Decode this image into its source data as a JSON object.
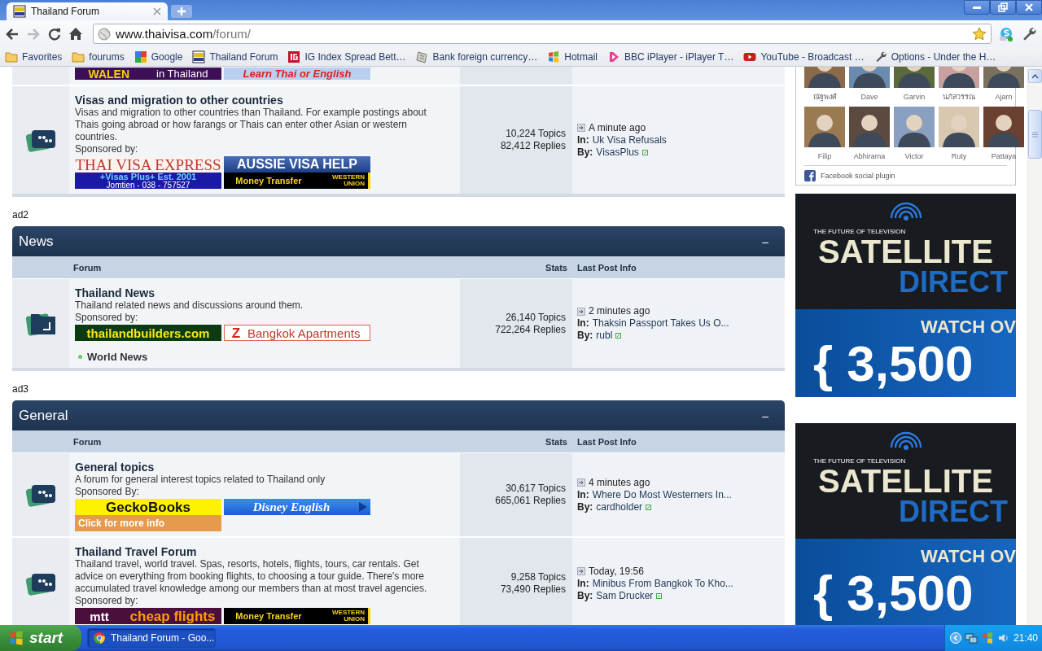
{
  "browser": {
    "tabs": [
      {
        "title": "Thailand Forum",
        "selected": true
      }
    ],
    "address": {
      "host": "www.thaivisa.com",
      "path": "/forum/"
    },
    "bookmarks": [
      {
        "kind": "folder",
        "label": "Favorites"
      },
      {
        "kind": "folder",
        "label": "fourums"
      },
      {
        "kind": "google",
        "label": "Google"
      },
      {
        "kind": "thaivisa",
        "label": "Thailand Forum"
      },
      {
        "kind": "ig",
        "label": "IG Index  Spread Bett…"
      },
      {
        "kind": "bank",
        "label": "Bank foreign currency…"
      },
      {
        "kind": "windows",
        "label": "Hotmail"
      },
      {
        "kind": "bbc",
        "label": "BBC iPlayer - iPlayer T…"
      },
      {
        "kind": "youtube",
        "label": "YouTube - Broadcast …"
      },
      {
        "kind": "wrench",
        "label": "Options - Under the H…"
      }
    ]
  },
  "forum": {
    "blocks": [
      {
        "kind": "rows",
        "rows": [
          {
            "kind": "partial",
            "banners": [
              {
                "kind": "walen",
                "lines": [
                  "WALEN",
                  "in Thailand"
                ]
              },
              {
                "kind": "learnthai",
                "lines": [
                  "Learn Thai or English"
                ]
              }
            ]
          },
          {
            "kind": "quote",
            "title": "Visas and migration to other countries",
            "description": "Visas and migration to other countries than Thailand. For example postings about Thais going abroad or how farangs or Thais can enter other Asian or western countries.",
            "sponsor_label": "Sponsored by:",
            "banners": [
              {
                "kind": "tve",
                "lines": [
                  "THAI VISA EXPRESS",
                  "+Visas Plus+ Est. 2001",
                  "Jomtien - 038 - 757527"
                ]
              },
              {
                "kind": "aussie",
                "lines": [
                  "AUSSIE VISA HELP",
                  "Money Transfer",
                  "WESTERN UNION"
                ]
              }
            ],
            "topics": "10,224 Topics",
            "replies": "82,412 Replies",
            "last": {
              "time": "A minute ago",
              "in_label": "In:",
              "topic": "Uk Visa Refusals",
              "by_label": "By:",
              "user": "VisasPlus"
            }
          }
        ]
      },
      {
        "kind": "ad_label",
        "text": "ad2"
      },
      {
        "kind": "section",
        "title": "News",
        "collapse": "–",
        "columns": [
          "Forum",
          "Stats",
          "Last Post Info"
        ],
        "rows": [
          {
            "kind": "folder",
            "title": "Thailand News",
            "description": "Thailand related news and discussions around them.",
            "sponsor_label": "Sponsored by:",
            "banners": [
              {
                "kind": "builders",
                "lines": [
                  "thailandbuilders.com"
                ]
              },
              {
                "kind": "bangkok",
                "lines": [
                  "Z",
                  "Bangkok Apartments"
                ]
              }
            ],
            "subforums": [
              "World News"
            ],
            "topics": "26,140 Topics",
            "replies": "722,264 Replies",
            "last": {
              "time": "2 minutes ago",
              "in_label": "In:",
              "topic": "Thaksin Passport Takes Us O...",
              "by_label": "By:",
              "user": "rubl"
            }
          }
        ]
      },
      {
        "kind": "ad_label",
        "text": "ad3"
      },
      {
        "kind": "section",
        "title": "General",
        "collapse": "–",
        "columns": [
          "Forum",
          "Stats",
          "Last Post Info"
        ],
        "rows": [
          {
            "kind": "quote",
            "title": "General topics",
            "description": "A forum for general interest topics related to Thailand only",
            "sponsor_label": "Sponsored By:",
            "banners": [
              {
                "kind": "gecko",
                "lines": [
                  "GeckoBooks",
                  "Click for more info"
                ]
              },
              {
                "kind": "disney",
                "lines": [
                  "Disney English"
                ]
              }
            ],
            "topics": "30,617 Topics",
            "replies": "665,061 Replies",
            "last": {
              "time": "4 minutes ago",
              "in_label": "In:",
              "topic": "Where Do Most Westerners In...",
              "by_label": "By:",
              "user": "cardholder"
            }
          },
          {
            "kind": "quote",
            "title": "Thailand Travel Forum",
            "description": "Thailand travel, world travel. Spas, resorts, hotels, flights, tours, car rentals. Get advice on everything from booking flights, to choosing a tour guide. There's more accumulated travel knowledge among our members than at most travel agencies.",
            "sponsor_label": "Sponsored by:",
            "banners": [
              {
                "kind": "mtt",
                "lines": [
                  "mtt",
                  "cheap flights"
                ]
              },
              {
                "kind": "western",
                "lines": [
                  "Money Transfer",
                  "WESTERN UNION"
                ]
              }
            ],
            "topics": "9,258 Topics",
            "replies": "73,490 Replies",
            "last": {
              "time": "Today, 19:56",
              "in_label": "In:",
              "topic": "Minibus From Bangkok To Kho...",
              "by_label": "By:",
              "user": "Sam Drucker"
            }
          }
        ]
      }
    ]
  },
  "sidebar": {
    "facebook": {
      "people": [
        {
          "name": "ณัฐพงศ์"
        },
        {
          "name": "Dave"
        },
        {
          "name": "Garvin"
        },
        {
          "name": "นภัสวรรณ"
        },
        {
          "name": "Ajarn"
        },
        {
          "name": "Filip"
        },
        {
          "name": "Abhirama"
        },
        {
          "name": "Victor"
        },
        {
          "name": "Ruty"
        },
        {
          "name": "Pattaya"
        }
      ],
      "footer": "Facebook social plugin"
    },
    "ads": [
      {
        "kind": "satellite",
        "tagline": "THE FUTURE OF TELEVISION",
        "brand": "SATELLITE",
        "brand2": "DIRECT",
        "cta": "WATCH OV",
        "number": "{ 3,500"
      },
      {
        "kind": "satellite",
        "tagline": "THE FUTURE OF TELEVISION",
        "brand": "SATELLITE",
        "brand2": "DIRECT",
        "cta": "WATCH OV",
        "number": "{ 3,500"
      }
    ]
  },
  "taskbar": {
    "start": "start",
    "tasks": [
      {
        "label": "Thailand Forum - Goo...",
        "selected": true
      }
    ],
    "clock": "21:40"
  }
}
